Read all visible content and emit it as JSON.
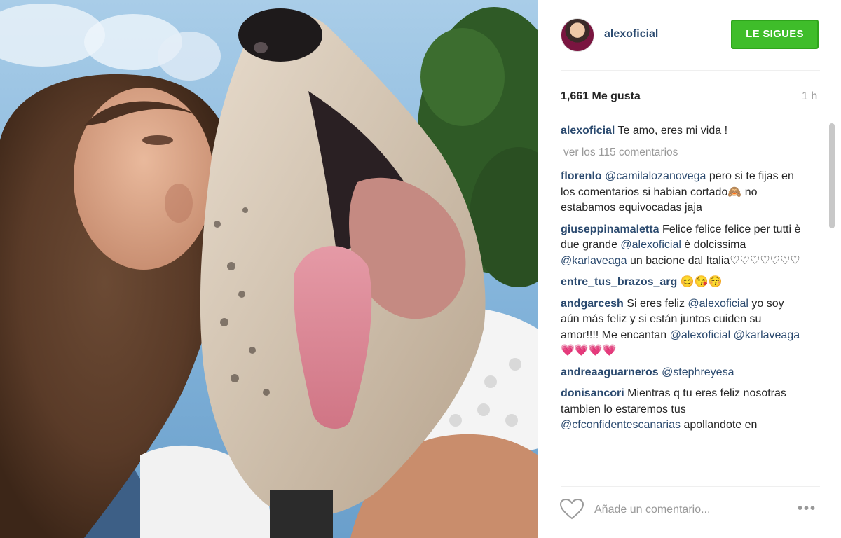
{
  "post": {
    "username": "alexoficial",
    "follow_label": "LE SIGUES",
    "likes": "1,661 Me gusta",
    "time": "1 h",
    "view_all": "ver los 115 comentarios",
    "comment_placeholder": "Añade un comentario...",
    "more_label": "•••"
  },
  "comments": [
    {
      "author": "alexoficial",
      "parts": [
        {
          "t": "Te amo, eres mi vida !"
        }
      ]
    },
    {
      "author": "florenlo",
      "parts": [
        {
          "m": "@camilalozanovega"
        },
        {
          "t": " pero si te fijas en los comentarios si habian cortado🙈 no estabamos equivocadas jaja"
        }
      ]
    },
    {
      "author": "giuseppinamaletta",
      "parts": [
        {
          "t": "Felice felice felice per tutti è due grande "
        },
        {
          "m": "@alexoficial"
        },
        {
          "t": " è dolcissima "
        },
        {
          "m": "@karlaveaga"
        },
        {
          "t": " un bacione dal Italia♡♡♡♡♡♡♡"
        }
      ]
    },
    {
      "author": "entre_tus_brazos_arg",
      "parts": [
        {
          "t": "😊😘😚"
        }
      ]
    },
    {
      "author": "andgarcesh",
      "parts": [
        {
          "t": "Si eres feliz "
        },
        {
          "m": "@alexoficial"
        },
        {
          "t": " yo soy aún más feliz y si están juntos cuiden su amor!!!! Me encantan "
        },
        {
          "m": "@alexoficial"
        },
        {
          "t": " "
        },
        {
          "m": "@karlaveaga"
        },
        {
          "t": " 💗💗💗💗"
        }
      ]
    },
    {
      "author": "andreaaguarneros",
      "parts": [
        {
          "m": "@stephreyesa"
        }
      ]
    },
    {
      "author": "donisancori",
      "parts": [
        {
          "t": "Mientras q tu eres feliz nosotras tambien lo estaremos tus "
        },
        {
          "m": "@cfconfidentescanarias"
        },
        {
          "t": " apollandote en"
        }
      ]
    }
  ],
  "colors": {
    "username": "#2b4a6f",
    "follow_button": "#3fbd2a",
    "muted": "#999999"
  },
  "icons": {
    "like": "heart-outline-icon",
    "options": "more-options-icon"
  }
}
